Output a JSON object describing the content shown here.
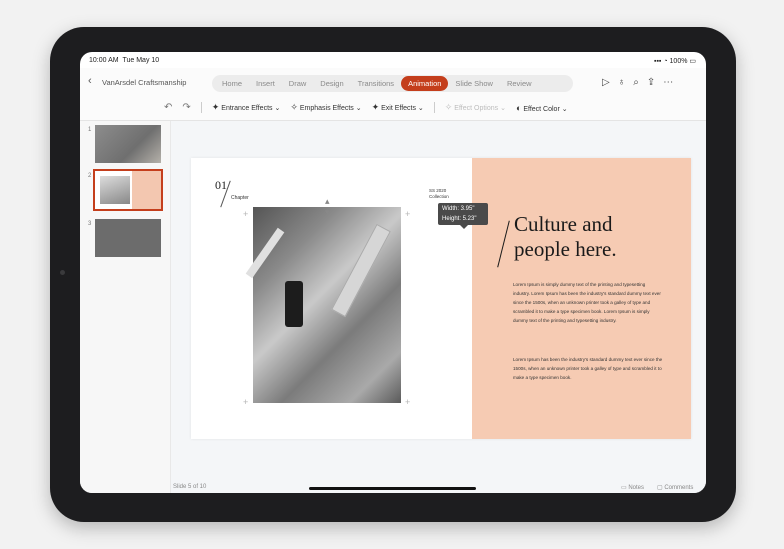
{
  "status": {
    "time": "10:00 AM",
    "date": "Tue May 10",
    "battery": "100%"
  },
  "header": {
    "doc_title": "VanArsdel Craftsmanship"
  },
  "tabs": [
    "Home",
    "Insert",
    "Draw",
    "Design",
    "Transitions",
    "Animation",
    "Slide Show",
    "Review"
  ],
  "active_tab": "Animation",
  "toolbar": {
    "entrance": "Entrance Effects",
    "emphasis": "Emphasis Effects",
    "exit": "Exit Effects",
    "options": "Effect Options",
    "color": "Effect Color"
  },
  "thumbnails": [
    {
      "num": "1"
    },
    {
      "num": "2"
    },
    {
      "num": "3"
    }
  ],
  "slide": {
    "chapter_num": "01",
    "chapter_label": "Chapter",
    "collection_line1": "SS 2020",
    "collection_line2": "Collection",
    "title_line1": "Culture and",
    "title_line2": "people here.",
    "para1": "Lorem Ipsum is simply dummy text of the printing and typesetting industry. Lorem Ipsum has been the industry's standard dummy text ever since the 1500s, when an unknown printer took a galley of type and scrambled it to make a type specimen book. Lorem Ipsum is simply dummy text of the printing and typesetting industry.",
    "para2": "Lorem Ipsum has been the industry's standard dummy text ever since the 1500s, when an unknown printer took a galley of type and scrambled it to make a type specimen book."
  },
  "tooltip": {
    "width": "Width: 3.95\"",
    "height": "Height: 5.23\""
  },
  "footer": {
    "slide_info": "Slide 5 of 10",
    "notes": "Notes",
    "comments": "Comments"
  },
  "colors": {
    "accent": "#c43e1c",
    "slide_panel": "#f6cbb3"
  }
}
